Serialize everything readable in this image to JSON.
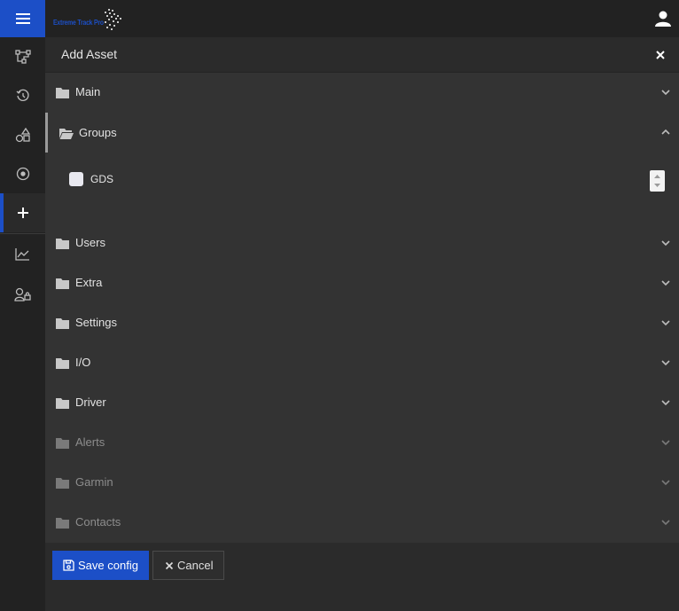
{
  "app": {
    "logo_text": "Extreme Track Pro"
  },
  "sidebar": {
    "items": [
      {
        "icon": "network-icon"
      },
      {
        "icon": "history-icon"
      },
      {
        "icon": "shapes-icon"
      },
      {
        "icon": "target-icon"
      },
      {
        "icon": "plus-icon",
        "active": true
      },
      {
        "icon": "chart-icon"
      },
      {
        "icon": "user-lock-icon"
      }
    ]
  },
  "panel": {
    "title": "Add Asset"
  },
  "sections": [
    {
      "label": "Main"
    },
    {
      "label": "Groups",
      "expanded": true
    },
    {
      "label": "Users"
    },
    {
      "label": "Extra"
    },
    {
      "label": "Settings"
    },
    {
      "label": "I/O"
    },
    {
      "label": "Driver"
    },
    {
      "label": "Alerts",
      "disabled": true
    },
    {
      "label": "Garmin",
      "disabled": true
    },
    {
      "label": "Contacts",
      "disabled": true
    }
  ],
  "groups": {
    "items": [
      {
        "label": "GDS",
        "checked": false
      }
    ]
  },
  "footer": {
    "save_label": "Save config",
    "cancel_label": "Cancel"
  },
  "colors": {
    "accent": "#1c4fc7",
    "background": "#333333",
    "sidebar": "#222222"
  }
}
